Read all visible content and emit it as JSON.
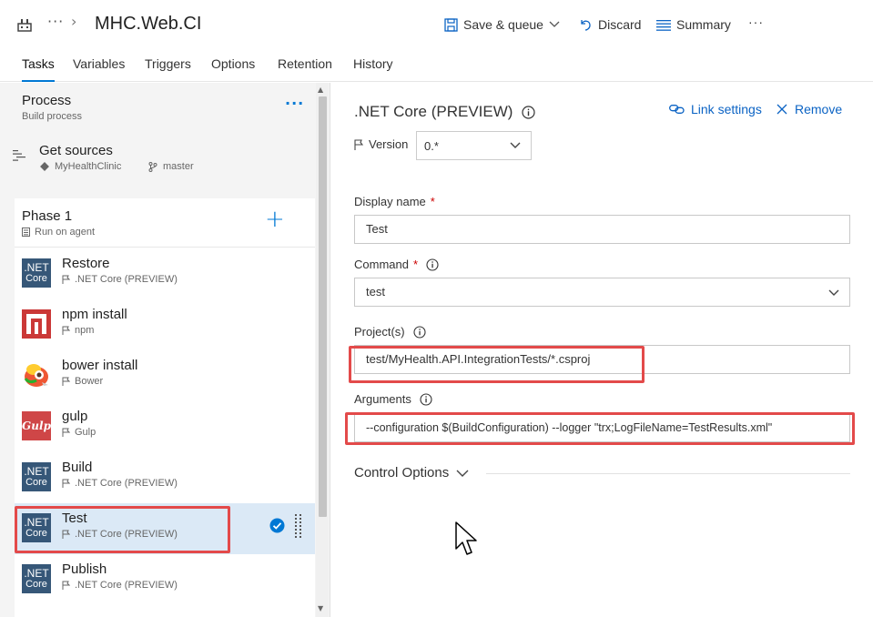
{
  "header": {
    "title": "MHC.Web.CI",
    "more_dots": "···",
    "save_queue": "Save & queue",
    "discard": "Discard",
    "summary": "Summary",
    "more": "···"
  },
  "tabs": [
    {
      "label": "Tasks",
      "active": true
    },
    {
      "label": "Variables"
    },
    {
      "label": "Triggers"
    },
    {
      "label": "Options"
    },
    {
      "label": "Retention"
    },
    {
      "label": "History"
    }
  ],
  "process": {
    "title": "Process",
    "subtitle": "Build process",
    "more": "···"
  },
  "get_sources": {
    "title": "Get sources",
    "repo": "MyHealthClinic",
    "branch": "master"
  },
  "phase": {
    "title": "Phase 1",
    "subtitle": "Run on agent",
    "add": "+"
  },
  "tasks": [
    {
      "name": "Restore",
      "sub": ".NET Core (PREVIEW)",
      "icon": "dotnet-core-icon"
    },
    {
      "name": "npm install",
      "sub": "npm",
      "icon": "npm-icon"
    },
    {
      "name": "bower install",
      "sub": "Bower",
      "icon": "bower-icon"
    },
    {
      "name": "gulp",
      "sub": "Gulp",
      "icon": "gulp-icon"
    },
    {
      "name": "Build",
      "sub": ".NET Core (PREVIEW)",
      "icon": "dotnet-core-icon"
    },
    {
      "name": "Test",
      "sub": ".NET Core (PREVIEW)",
      "icon": "dotnet-core-icon",
      "selected": true
    },
    {
      "name": "Publish",
      "sub": ".NET Core (PREVIEW)",
      "icon": "dotnet-core-icon"
    }
  ],
  "net_icon": {
    "line1": ".NET",
    "line2": "Core"
  },
  "gulp_text": "Gulp",
  "detail": {
    "title": ".NET Core (PREVIEW)",
    "link_settings": "Link settings",
    "remove": "Remove",
    "version_label": "Version",
    "version_value": "0.*",
    "display_name_label": "Display name",
    "display_name_value": "Test",
    "command_label": "Command",
    "command_value": "test",
    "projects_label": "Project(s)",
    "projects_value": "test/MyHealth.API.IntegrationTests/*.csproj",
    "arguments_label": "Arguments",
    "arguments_value": "--configuration $(BuildConfiguration) --logger \"trx;LogFileName=TestResults.xml\"",
    "control_options": "Control Options",
    "required_mark": "*"
  },
  "colors": {
    "accent": "#0078d4",
    "highlight": "#e34a4a",
    "selected_row": "#dbe9f6",
    "net_core": "#365778"
  }
}
